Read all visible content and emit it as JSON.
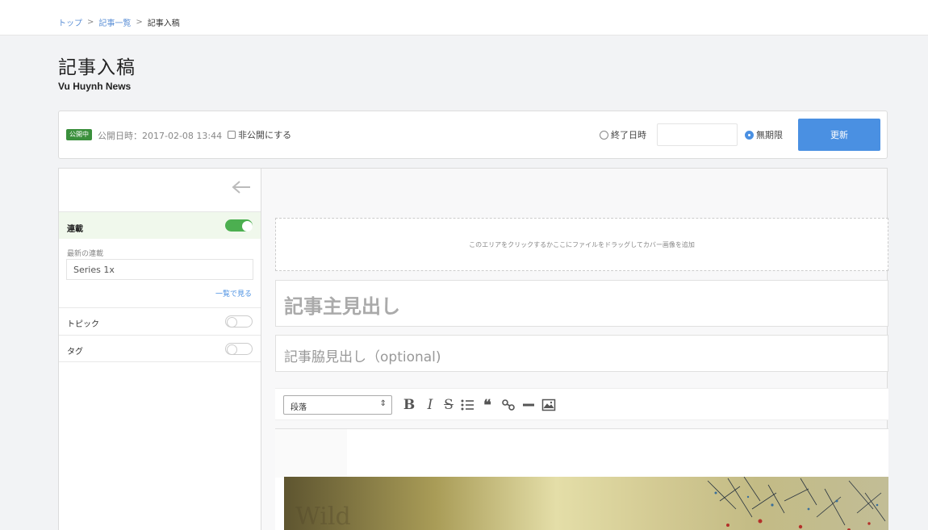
{
  "breadcrumb": {
    "items": [
      "トップ",
      "記事一覧"
    ],
    "separator": ">",
    "current": "記事入稿"
  },
  "page": {
    "title": "記事入稿",
    "subtitle": "Vu Huynh News"
  },
  "publish_bar": {
    "badge": "公開中",
    "date_text": "公開日時：2017-02-08 13:44",
    "private_label": "非公開にする",
    "end_date_label": "終了日時",
    "end_date_value": "",
    "unlimited_label": "無期限",
    "update_button": "更新"
  },
  "sidebar": {
    "series_label": "連載",
    "series_enabled": true,
    "latest_series_label": "最新の連載",
    "latest_series_value": "Series 1x",
    "list_link": "一覧で見る",
    "topic_label": "トピック",
    "topic_enabled": false,
    "tag_label": "タグ",
    "tag_enabled": false
  },
  "editor": {
    "cover_placeholder": "このエリアをクリックするかここにファイルをドラッグしてカバー画像を追加",
    "headline_placeholder": "記事主見出し",
    "subheadline_placeholder": "記事脇見出し（optional)",
    "format_select": "段落",
    "toolbar_icons": [
      "bold-icon",
      "italic-icon",
      "strikethrough-icon",
      "bullet-list-icon",
      "quote-icon",
      "link-icon",
      "horizontal-rule-icon",
      "image-icon"
    ],
    "image_text": "Wild"
  },
  "colors": {
    "accent": "#4a90e2",
    "badge": "#3a8f3c",
    "toggle_on": "#4caf50",
    "background": "#f2f3f5"
  }
}
